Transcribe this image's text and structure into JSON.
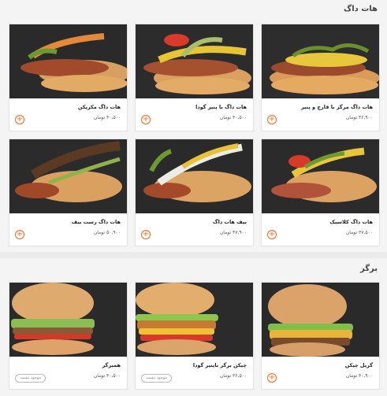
{
  "sections": [
    {
      "title": "هات داگ",
      "items": [
        {
          "name": "هات داگ مرگز با قارچ و پنیر",
          "price": "۴۶,۹۰۰ تومان",
          "status": "add"
        },
        {
          "name": "هات داگ با پنیر گودا",
          "price": "۴۰,۵۰۰ تومان",
          "status": "add"
        },
        {
          "name": "هات داگ مکزیکن",
          "price": "۴۰,۵۰۰ تومان",
          "status": "add"
        },
        {
          "name": "هات داگ کلاسیک",
          "price": "۳۷,۵۰۰ تومان",
          "status": "add"
        },
        {
          "name": "بیف هات داگ",
          "price": "۴۷,۹۰۰ تومان",
          "status": "add"
        },
        {
          "name": "هات داگ رست بیف",
          "price": "۵۰,۹۰۰ تومان",
          "status": "add"
        }
      ]
    },
    {
      "title": "برگر",
      "items": [
        {
          "name": "گریل چیکن",
          "price": "۴۰,۹۰۰ تومان",
          "status": "add"
        },
        {
          "name": "چیکن برگر باپنیر گودا",
          "price": "۳۶,۵۰۰ تومان",
          "status": "unavailable"
        },
        {
          "name": "همبرگر",
          "price": "۴۰,۵۰۰ تومان",
          "status": "unavailable"
        }
      ]
    }
  ],
  "unavailable_label": "موجود نیست",
  "add_symbol": "+",
  "colors": {
    "accent": "#f26b1d",
    "image_bg": "#2b2b2b",
    "page_bg": "#f4f4f4"
  }
}
